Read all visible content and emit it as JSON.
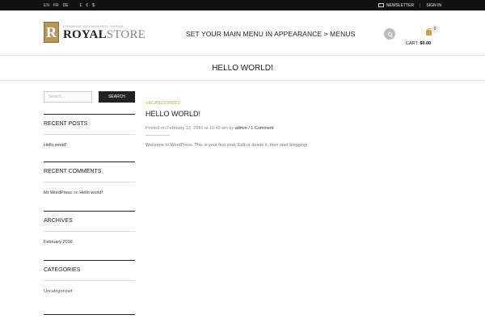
{
  "topbar": {
    "languages": [
      "EN",
      "FR",
      "DE"
    ],
    "currencies": [
      "£",
      "€",
      "$"
    ],
    "newsletter": "NEWSLETTER",
    "separator": "|",
    "sign_in": "SIGN IN"
  },
  "header": {
    "logo_letter": "R",
    "logo_tagline": "PREMIUM ECOMMERCE THEME",
    "logo_name_1": "ROYAL",
    "logo_name_2": "STORE",
    "menu_notice": "SET YOUR MAIN MENU IN APPEARANCE > MENUS",
    "cart_count": "0",
    "cart_label": "CART:",
    "cart_total": "$0.00"
  },
  "page_title": "HELLO WORLD!",
  "sidebar": {
    "search_placeholder": "Search...",
    "search_button": "SEARCH",
    "recent_posts_title": "RECENT POSTS",
    "recent_posts": [
      "Hello world!"
    ],
    "recent_comments_title": "RECENT COMMENTS",
    "comment_author": "Mr WordPress",
    "comment_on": "on",
    "comment_post": "Hello world!",
    "archives_title": "ARCHIVES",
    "archives": [
      "February 2016"
    ],
    "categories_title": "CATEGORIES",
    "categories": [
      "Uncategorized"
    ]
  },
  "post": {
    "category": "UNCATEGORIZED",
    "title": "HELLO WORLD!",
    "meta_prefix": "Posted on February 12, 2016 at 10:42 am by",
    "author": "admin",
    "meta_sep": " / ",
    "comments": "1 Comment",
    "body": "Welcome to WordPress. This is your first post. Edit or delete it, then start blogging!"
  },
  "colors": {
    "accent_gold": "#c9a24b",
    "topbar_bg": "#111111",
    "button_dark": "#222222"
  }
}
